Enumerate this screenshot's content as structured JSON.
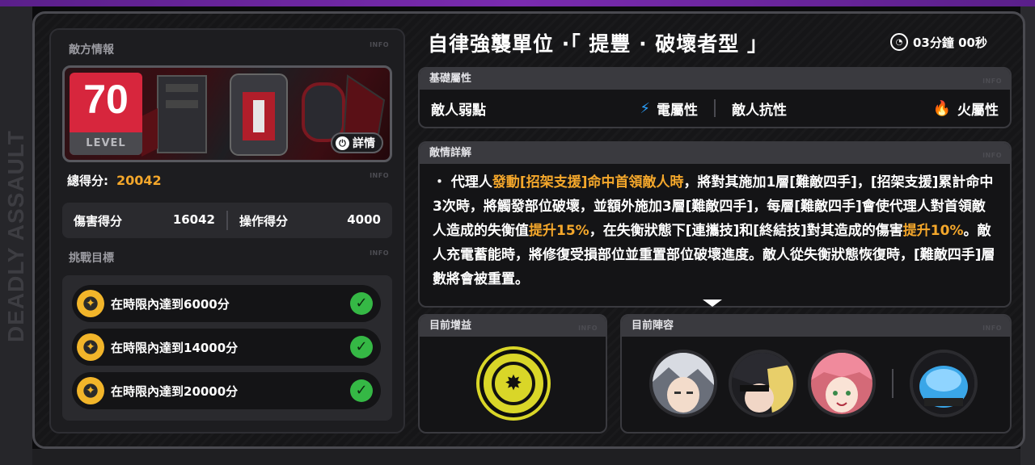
{
  "side_banner": "DEADLY ASSAULT",
  "left": {
    "enemy_info_title": "敵方情報",
    "info_tag": "INFO",
    "level": "70",
    "level_label": "LEVEL",
    "detail_button": "詳情",
    "total_score_label": "總得分:",
    "total_score_value": "20042",
    "damage_label": "傷害得分",
    "damage_value": "16042",
    "operation_label": "操作得分",
    "operation_value": "4000",
    "challenge_title": "挑戰目標",
    "goals": [
      {
        "text": "在時限內達到6000分",
        "done": true
      },
      {
        "text": "在時限內達到14000分",
        "done": true
      },
      {
        "text": "在時限內達到20000分",
        "done": true
      }
    ]
  },
  "boss": {
    "title": "自律強襲單位 ·「 提豐 · 破壞者型 」",
    "timer": "03分鐘 00秒"
  },
  "attributes": {
    "title": "基礎屬性",
    "weakness_label": "敵人弱點",
    "weakness_value": "電屬性",
    "resist_label": "敵人抗性",
    "resist_value": "火屬性"
  },
  "details": {
    "title": "敵情詳解",
    "segments": [
      {
        "t": "・ 代理人",
        "hl": false
      },
      {
        "t": "發動[招架支援]命中首領敵人時",
        "hl": true
      },
      {
        "t": "，將對其施加1層[難敵四手]，[招架支援]累計命中3次時，將觸發部位破壞，並額外施加3層[難敵四手]，每層[難敵四手]會使代理人對首領敵人造成的失衡值",
        "hl": false
      },
      {
        "t": "提升15%",
        "hl": true
      },
      {
        "t": "，在失衡狀態下[連攜技]和[終結技]對其造成的傷害",
        "hl": false
      },
      {
        "t": "提升10%",
        "hl": true
      },
      {
        "t": "。敵人充電蓄能時，將修復受損部位並重置部位破壞進度。敵人從失衡狀態恢復時，[難敵四手]層數將會被重置。",
        "hl": false
      }
    ]
  },
  "buff": {
    "title": "目前增益"
  },
  "team": {
    "title": "目前陣容"
  },
  "colors": {
    "accent": "#f4a72b",
    "level_red": "#d7263d",
    "electric": "#2aa0ff",
    "fire": "#ff5a28",
    "check": "#35b845"
  }
}
